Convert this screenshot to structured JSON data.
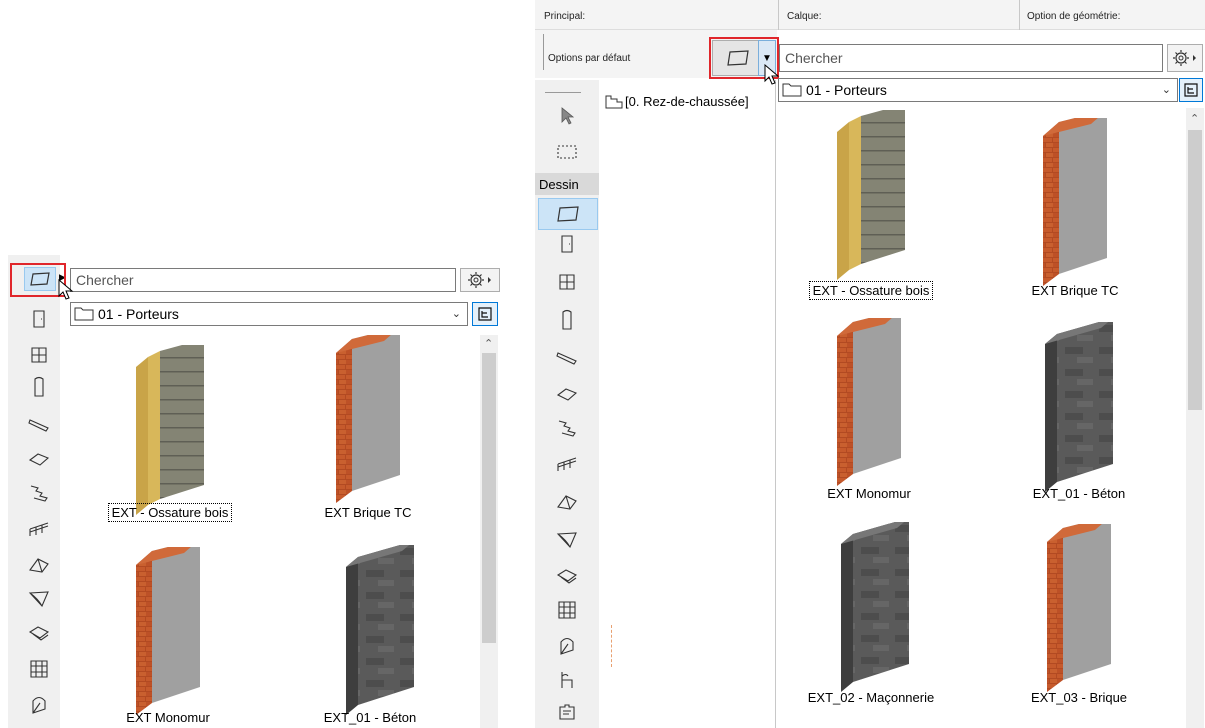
{
  "colors": {
    "accent": "#0078d7",
    "highlight_box": "#e0262b",
    "selected_tool": "#cce4f7"
  },
  "left_panel": {
    "search_placeholder": "Chercher",
    "folder": "01 - Porteurs",
    "items": [
      {
        "label": "EXT - Ossature bois",
        "material": "wood-frame"
      },
      {
        "label": "EXT Brique TC",
        "material": "brick"
      },
      {
        "label": "EXT Monomur",
        "material": "brick"
      },
      {
        "label": "EXT_01 - Béton",
        "material": "concrete"
      }
    ]
  },
  "right_panel": {
    "headers": {
      "principal": "Principal:",
      "calque": "Calque:",
      "option": "Option de géométrie:"
    },
    "default_options": "Options par défaut",
    "search_placeholder": "Chercher",
    "folder": "01 - Porteurs",
    "story": "[0. Rez-de-chaussée]",
    "section_label": "Dessin",
    "items": [
      {
        "label": "EXT - Ossature bois",
        "material": "wood-frame"
      },
      {
        "label": "EXT Brique TC",
        "material": "brick"
      },
      {
        "label": "EXT Monomur",
        "material": "brick"
      },
      {
        "label": "EXT_01 - Béton",
        "material": "concrete"
      },
      {
        "label": "EXT_02 - Maçonnerie",
        "material": "concrete"
      },
      {
        "label": "EXT_03 - Brique",
        "material": "brick"
      }
    ]
  }
}
